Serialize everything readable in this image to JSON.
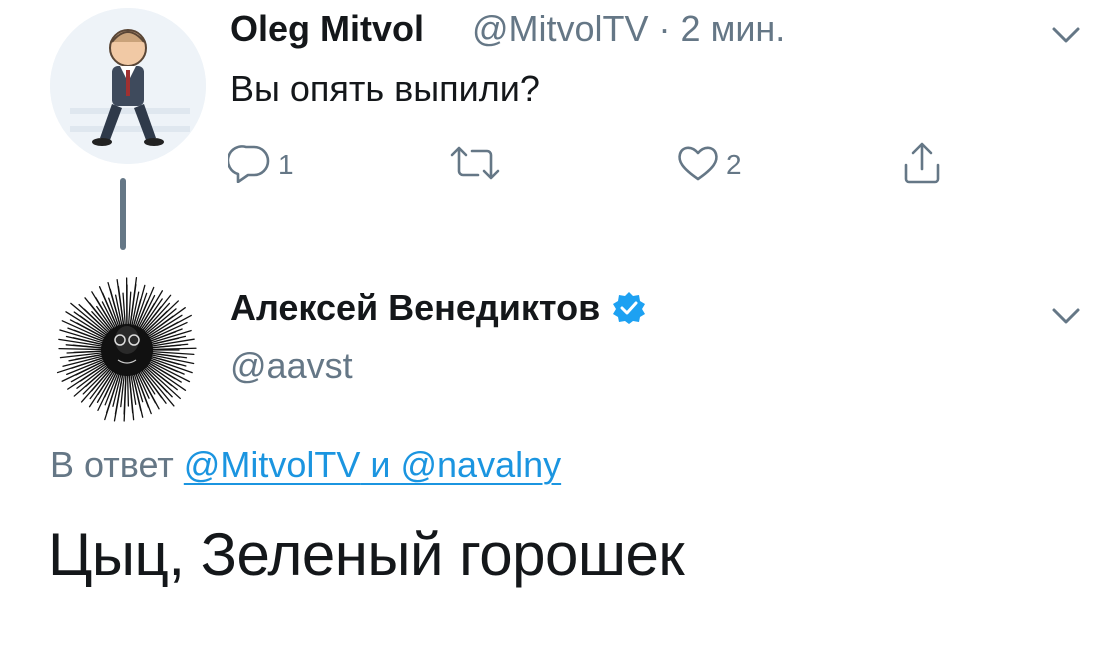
{
  "tweet1": {
    "author_name": "Oleg Mitvol",
    "handle_time": "@MitvolTV · 2 мин.",
    "text": "Вы опять выпили?",
    "reply_count": "1",
    "like_count": "2"
  },
  "tweet2": {
    "author_name": "Алексей Венедиктов",
    "handle": "@aavst",
    "reply_prefix": "В ответ",
    "mention1": "@MitvolTV",
    "joiner": " и ",
    "mention2": "@navalny",
    "text": "Цыц, Зеленый горошек"
  },
  "colors": {
    "text": "#14171a",
    "secondary": "#657786",
    "link": "#1b95e0",
    "verified": "#1da1f2"
  }
}
